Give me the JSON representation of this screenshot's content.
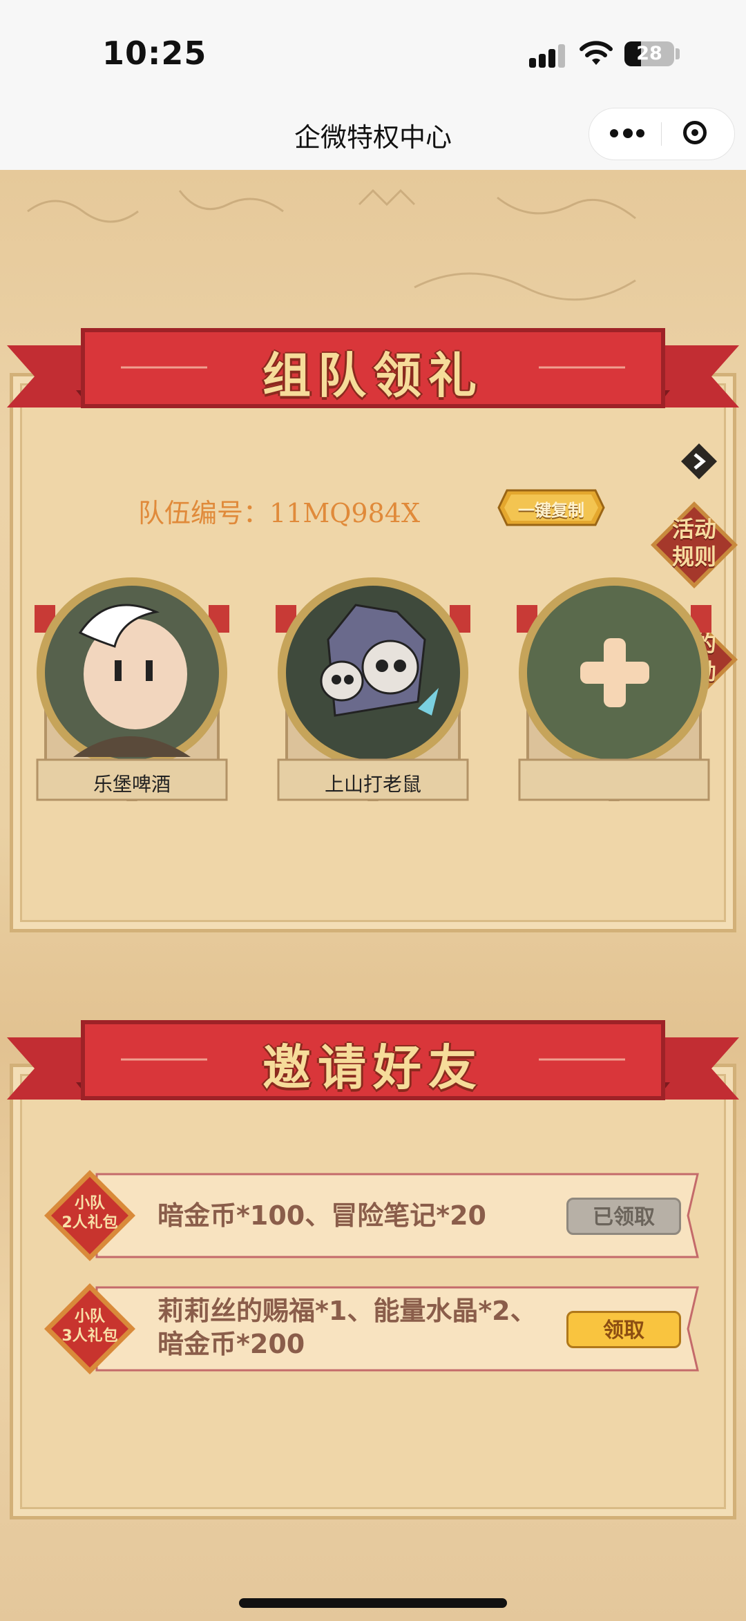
{
  "status_bar": {
    "time": "10:25",
    "battery": "28"
  },
  "nav": {
    "title": "企微特权中心"
  },
  "team_section": {
    "title": "组队领礼",
    "team_label": "队伍编号：",
    "team_id": "11MQ984X",
    "copy_button": "一键复制",
    "rules_button": [
      "活动",
      "规则"
    ],
    "rewards_button": [
      "我的",
      "奖励"
    ],
    "members": [
      {
        "name": "乐堡啤酒"
      },
      {
        "name": "上山打老鼠"
      },
      {
        "name": ""
      }
    ]
  },
  "invite_section": {
    "title": "邀请好友",
    "rewards": [
      {
        "badge": [
          "小队",
          "2人礼包"
        ],
        "text_lines": [
          "暗金币*100、冒险笔记*20"
        ],
        "button": "已领取",
        "state": "claimed"
      },
      {
        "badge": [
          "小队",
          "3人礼包"
        ],
        "text_lines": [
          "莉莉丝的赐福*1、能量水晶*2、",
          "暗金币*200"
        ],
        "button": "领取",
        "state": "available"
      }
    ]
  },
  "colors": {
    "ribbon_red": "#d9363a",
    "parchment": "#efd6a8",
    "team_label": "#e08a3a",
    "claim_yellow": "#f9c43f",
    "claimed_gray": "#b7b0a6"
  }
}
